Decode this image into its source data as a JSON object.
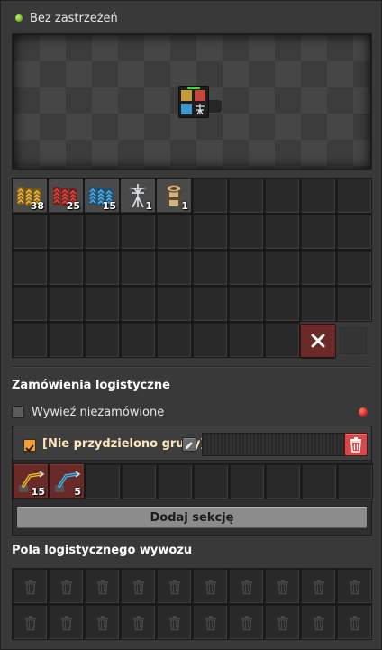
{
  "status": {
    "text": "Bez zastrzeżeń",
    "color": "#5fae1f"
  },
  "inventory": {
    "slots": [
      {
        "icon": "yellow-transport-belt-icon",
        "count": "38",
        "colors": [
          "#e3b13a",
          "#7a5a18"
        ]
      },
      {
        "icon": "red-transport-belt-icon",
        "count": "25",
        "colors": [
          "#d6453c",
          "#6e1d18"
        ]
      },
      {
        "icon": "blue-transport-belt-icon",
        "count": "15",
        "colors": [
          "#4aa8e0",
          "#1a4e70"
        ]
      },
      {
        "icon": "electric-pole-icon",
        "count": "1",
        "colors": [
          "#dfe4ea",
          "#6b7278"
        ]
      },
      {
        "icon": "pipe-icon",
        "count": "1",
        "colors": [
          "#cdb486",
          "#5a4a2a"
        ]
      }
    ],
    "trash_icon": "close-icon"
  },
  "logistics": {
    "heading": "Zamówienia logistyczne",
    "trash_unrequested_label": "Wywieź niezamówione",
    "status_color": "#d01818",
    "group": {
      "title": "[Nie przydzielono grupy]",
      "edit_icon": "pencil-icon",
      "delete_icon": "trash-icon"
    },
    "requests": [
      {
        "icon": "yellow-inserter-icon",
        "count": "15",
        "colors": [
          "#f0c038",
          "#6a4d10"
        ]
      },
      {
        "icon": "blue-inserter-icon",
        "count": "5",
        "colors": [
          "#4fb8ee",
          "#17506e"
        ]
      }
    ],
    "add_section_label": "Dodaj sekcję"
  },
  "trash_slots": {
    "heading": "Pola logistycznego wywozu",
    "icon": "trash-icon"
  }
}
